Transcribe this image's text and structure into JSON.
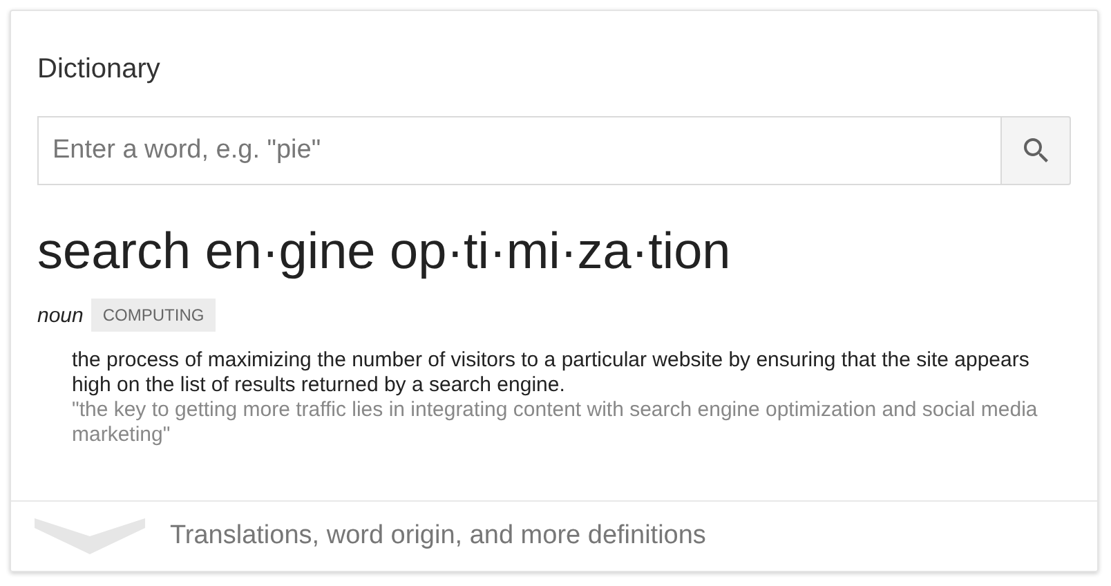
{
  "card": {
    "title": "Dictionary",
    "search": {
      "placeholder": "Enter a word, e.g. \"pie\""
    },
    "entry": {
      "headword": "search en·gine op·ti·mi·za·tion",
      "part_of_speech": "noun",
      "label": "COMPUTING",
      "definitions": [
        {
          "text": "the process of maximizing the number of visitors to a particular website by ensuring that the site appears high on the list of results returned by a search engine.",
          "example": "\"the key to getting more traffic lies in integrating content with search engine optimization and social media marketing\""
        }
      ]
    },
    "footer": {
      "text": "Translations, word origin, and more definitions",
      "expanded": false
    }
  }
}
